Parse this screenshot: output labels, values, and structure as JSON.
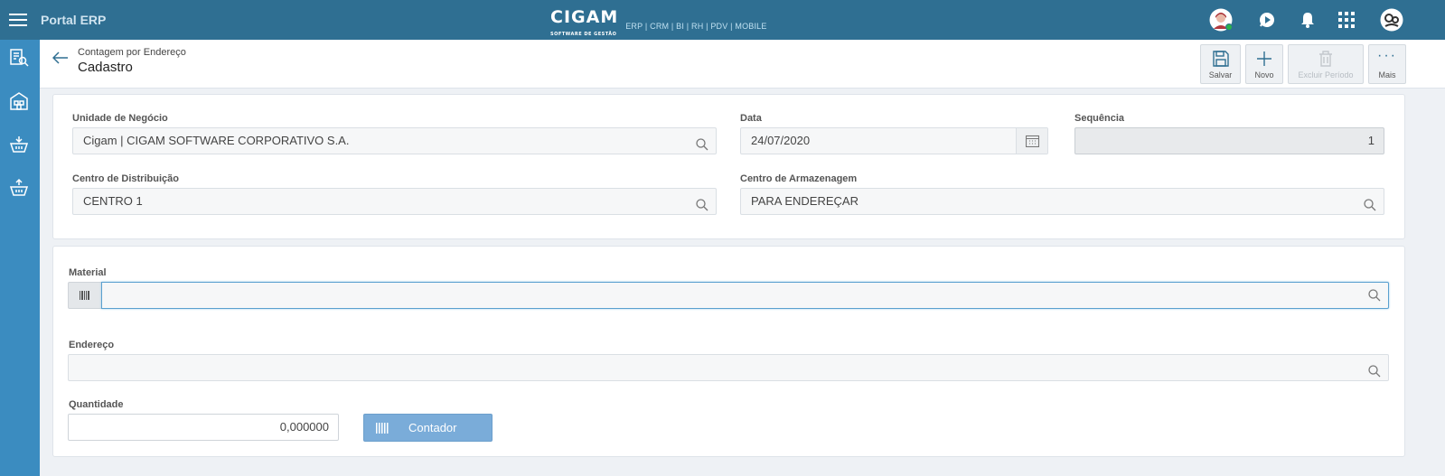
{
  "topbar": {
    "title": "Portal ERP",
    "brand_logo": "CIGAM",
    "brand_sub": "SOFTWARE DE GESTÃO",
    "brand_modules": "ERP | CRM | BI | RH | PDV | MOBILE"
  },
  "header": {
    "breadcrumb": "Contagem por Endereço",
    "title": "Cadastro",
    "tools": {
      "save": "Salvar",
      "new": "Novo",
      "delete_period": "Excluir Período",
      "more": "Mais"
    }
  },
  "form": {
    "unidade_label": "Unidade de Negócio",
    "unidade_value": "Cigam | CIGAM SOFTWARE CORPORATIVO S.A.",
    "data_label": "Data",
    "data_value": "24/07/2020",
    "sequencia_label": "Sequência",
    "sequencia_value": "1",
    "centro_dist_label": "Centro de Distribuição",
    "centro_dist_value": "CENTRO 1",
    "centro_arm_label": "Centro de Armazenagem",
    "centro_arm_value": "PARA ENDEREÇAR"
  },
  "count": {
    "material_label": "Material",
    "material_value": "",
    "endereco_label": "Endereço",
    "endereco_value": "",
    "quantidade_label": "Quantidade",
    "quantidade_value": "0,000000",
    "contador_label": "Contador"
  },
  "colors": {
    "topbar": "#2f6f92",
    "rail": "#3b8cc0",
    "button": "#7aacd9"
  }
}
